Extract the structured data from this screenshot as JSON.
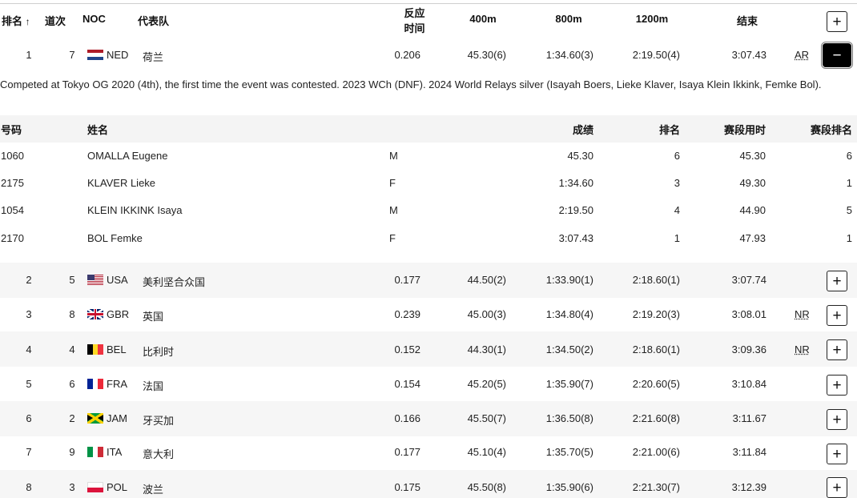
{
  "header": {
    "rank": "排名",
    "sort_arrow": "↑",
    "lane": "道次",
    "noc": "NOC",
    "team": "代表队",
    "reaction_l1": "反应",
    "reaction_l2": "时间",
    "s400": "400m",
    "s800": "800m",
    "s1200": "1200m",
    "result": "结束"
  },
  "expanded": {
    "rank": "1",
    "lane": "7",
    "noc": "NED",
    "team": "荷兰",
    "reaction": "0.206",
    "s400": "45.30(6)",
    "s800": "1:34.60(3)",
    "s1200": "2:19.50(4)",
    "result": "3:07.43",
    "record": "AR",
    "note": "Competed at Tokyo OG 2020 (4th), the first time the event was contested. 2023 WCh (DNF). 2024 World Relays silver (Isayah Boers, Lieke Klaver, Isaya Klein Ikkink, Femke Bol).",
    "sub_header": {
      "bib": "号码",
      "name": "姓名",
      "mark": "成绩",
      "place": "排名",
      "split": "赛段用时",
      "split_rank": "赛段排名"
    },
    "athletes": [
      {
        "bib": "1060",
        "name": "OMALLA Eugene",
        "sex": "M",
        "mark": "45.30",
        "place": "6",
        "split": "45.30",
        "split_rank": "6"
      },
      {
        "bib": "2175",
        "name": "KLAVER Lieke",
        "sex": "F",
        "mark": "1:34.60",
        "place": "3",
        "split": "49.30",
        "split_rank": "1"
      },
      {
        "bib": "1054",
        "name": "KLEIN IKKINK Isaya",
        "sex": "M",
        "mark": "2:19.50",
        "place": "4",
        "split": "44.90",
        "split_rank": "5"
      },
      {
        "bib": "2170",
        "name": "BOL Femke",
        "sex": "F",
        "mark": "3:07.43",
        "place": "1",
        "split": "47.93",
        "split_rank": "1"
      }
    ]
  },
  "rows": [
    {
      "rank": "2",
      "lane": "5",
      "noc": "USA",
      "team": "美利坚合众国",
      "reaction": "0.177",
      "s400": "44.50(2)",
      "s800": "1:33.90(1)",
      "s1200": "2:18.60(1)",
      "result": "3:07.74",
      "record": ""
    },
    {
      "rank": "3",
      "lane": "8",
      "noc": "GBR",
      "team": "英国",
      "reaction": "0.239",
      "s400": "45.00(3)",
      "s800": "1:34.80(4)",
      "s1200": "2:19.20(3)",
      "result": "3:08.01",
      "record": "NR"
    },
    {
      "rank": "4",
      "lane": "4",
      "noc": "BEL",
      "team": "比利时",
      "reaction": "0.152",
      "s400": "44.30(1)",
      "s800": "1:34.50(2)",
      "s1200": "2:18.60(1)",
      "result": "3:09.36",
      "record": "NR"
    },
    {
      "rank": "5",
      "lane": "6",
      "noc": "FRA",
      "team": "法国",
      "reaction": "0.154",
      "s400": "45.20(5)",
      "s800": "1:35.90(7)",
      "s1200": "2:20.60(5)",
      "result": "3:10.84",
      "record": ""
    },
    {
      "rank": "6",
      "lane": "2",
      "noc": "JAM",
      "team": "牙买加",
      "reaction": "0.166",
      "s400": "45.50(7)",
      "s800": "1:36.50(8)",
      "s1200": "2:21.60(8)",
      "result": "3:11.67",
      "record": ""
    },
    {
      "rank": "7",
      "lane": "9",
      "noc": "ITA",
      "team": "意大利",
      "reaction": "0.177",
      "s400": "45.10(4)",
      "s800": "1:35.70(5)",
      "s1200": "2:21.00(6)",
      "result": "3:11.84",
      "record": ""
    },
    {
      "rank": "8",
      "lane": "3",
      "noc": "POL",
      "team": "波兰",
      "reaction": "0.175",
      "s400": "45.50(8)",
      "s800": "1:35.90(6)",
      "s1200": "2:21.30(7)",
      "result": "3:12.39",
      "record": ""
    }
  ],
  "icons": {
    "expand": "+",
    "collapse": "−"
  }
}
